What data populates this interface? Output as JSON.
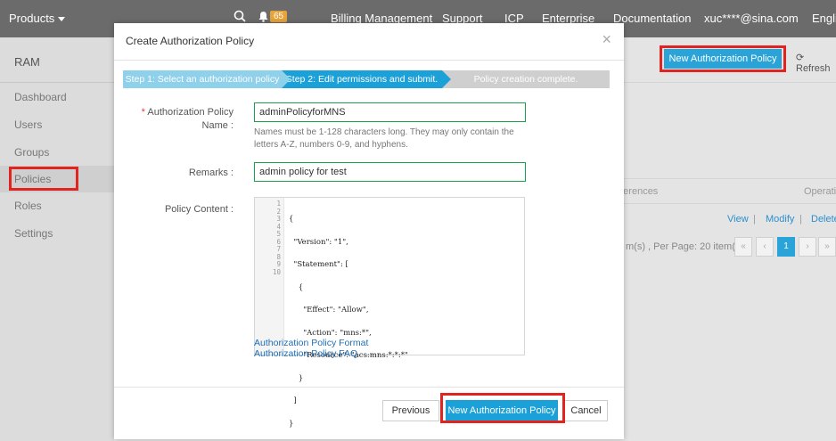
{
  "topnav": {
    "products": "Products",
    "badge": "65",
    "items": [
      "Billing Management",
      "Support",
      "ICP",
      "Enterprise",
      "Documentation",
      "xuc****@sina.com",
      "Engli"
    ]
  },
  "sidebar": {
    "title": "RAM",
    "items": [
      "Dashboard",
      "Users",
      "Groups",
      "Policies",
      "Roles",
      "Settings"
    ],
    "active": "Policies"
  },
  "background": {
    "new_policy_button": "New Authorization Policy",
    "refresh": "Refresh",
    "col_references": "eferences",
    "col_operations": "Operatio",
    "row_view": "View",
    "row_sep1": "|",
    "row_modify": "Modify",
    "row_sep2": "|",
    "row_delete": "Delete",
    "pagination_text": "m(s) ,  Per Page: 20 item(s)",
    "pager_first": "«",
    "pager_prev": "‹",
    "pager_current": "1",
    "pager_next": "›",
    "pager_last": "»"
  },
  "modal": {
    "title": "Create Authorization Policy",
    "close": "×",
    "steps": [
      "Step 1: Select an authorization policy",
      "Step 2: Edit permissions and submit.",
      "Policy creation complete."
    ],
    "fields": {
      "name_required": "*",
      "name_label_line1": "Authorization Policy",
      "name_label_line2": "Name :",
      "name_value": "adminPolicyforMNS",
      "name_hint": "Names must be 1-128 characters long. They may only contain the letters A-Z, numbers 0-9, and hyphens.",
      "remarks_label": "Remarks :",
      "remarks_value": "admin policy for test",
      "content_label": "Policy Content :"
    },
    "policy_lines": [
      "{",
      "  \"Version\": \"1\",",
      "  \"Statement\": [",
      "    {",
      "      \"Effect\": \"Allow\",",
      "      \"Action\": \"mns:*\",",
      "      \"Resource\": \"acs:mns:*:*:*\"",
      "    }",
      "  ]",
      "}"
    ],
    "line_numbers": [
      "1",
      "2",
      "3",
      "4",
      "5",
      "6",
      "7",
      "8",
      "9",
      "10"
    ],
    "links": [
      "Authorization Policy Format",
      "Authorization Policy FAQ"
    ],
    "buttons": {
      "previous": "Previous",
      "submit": "New Authorization Policy",
      "cancel": "Cancel"
    }
  },
  "colors": {
    "accent": "#1ba1d8",
    "highlight_box": "#e0241f",
    "input_border": "#1aa24b"
  }
}
